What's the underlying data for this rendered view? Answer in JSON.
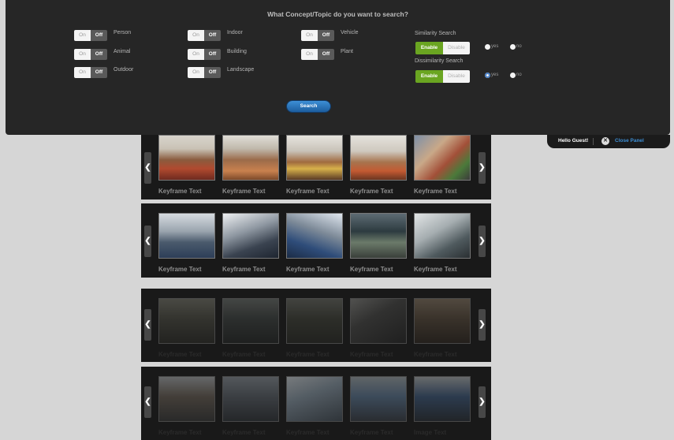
{
  "panel": {
    "title": "What Concept/Topic do you want to search?",
    "toggle_on_label": "On",
    "toggle_off_label": "Off",
    "concepts": [
      {
        "label": "Person"
      },
      {
        "label": "Animal"
      },
      {
        "label": "Outdoor"
      },
      {
        "label": "Indoor"
      },
      {
        "label": "Building"
      },
      {
        "label": "Landscape"
      },
      {
        "label": "Vehicle"
      },
      {
        "label": "Plant"
      }
    ],
    "similarity": {
      "heading": "Similarity Search",
      "enable_label": "Enable",
      "disable_label": "Disable",
      "yes_label": "yes",
      "no_label": "no",
      "yes_selected": false
    },
    "dissimilarity": {
      "heading": "Dissimilarity Search",
      "enable_label": "Enable",
      "disable_label": "Disable",
      "yes_label": "yes",
      "no_label": "no",
      "yes_selected": true
    },
    "search_label": "Search"
  },
  "guest": {
    "greeting": "Hello Guest!",
    "close_label": "Close Panel"
  },
  "colors": {
    "panel_bg": "#262626",
    "enable_green": "#6aa521",
    "search_blue": "#2a78c4",
    "link_blue": "#3d8fd6"
  },
  "rows": [
    {
      "labels": [
        "Keyframe Text",
        "Keyframe Text",
        "Keyframe Text",
        "Keyframe Text",
        "Keyframe Text"
      ]
    },
    {
      "labels": [
        "Keyframe Text",
        "Keyframe Text",
        "Keyframe Text",
        "Keyframe Text",
        "Keyframe Text"
      ]
    },
    {
      "labels": [
        "Keyframe Text",
        "Keyframe Text",
        "Keyframe Text",
        "Keyframe Text",
        "Keyframe Text"
      ]
    },
    {
      "labels": [
        "Keyframe Text",
        "Keyframe Text",
        "Keyframe Text",
        "Keyframe Text",
        "Image Text"
      ]
    }
  ],
  "arrows": {
    "left": "❮",
    "right": "❯"
  },
  "close_glyph": "✕"
}
